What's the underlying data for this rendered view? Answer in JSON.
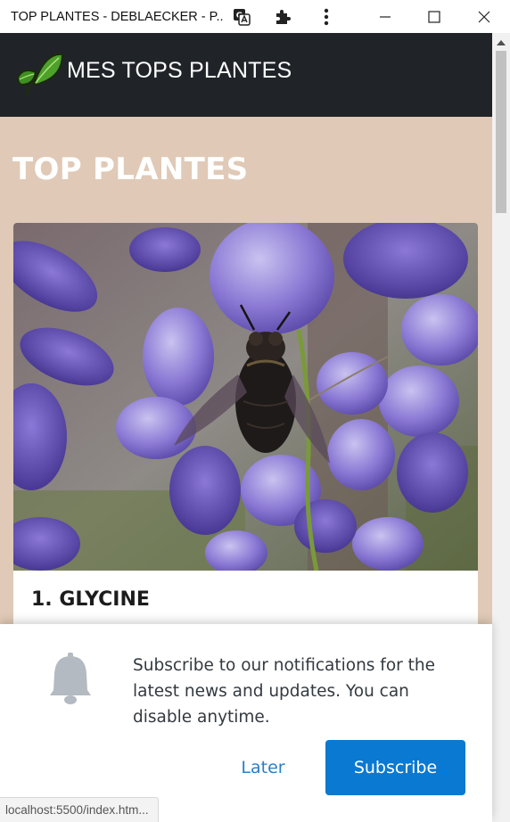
{
  "window": {
    "title": "TOP PLANTES - DEBLAECKER - P...",
    "icons": [
      "translate-icon",
      "extensions-icon",
      "more-menu-icon"
    ],
    "controls": [
      "minimize-icon",
      "maximize-icon",
      "close-icon"
    ]
  },
  "navbar": {
    "brand": "MES TOPS PLANTES",
    "logo": "leaf-logo"
  },
  "main": {
    "heading": "TOP PLANTES",
    "cards": [
      {
        "title": "1. GLYCINE",
        "image": "wisteria-with-bee-photo"
      }
    ]
  },
  "notification": {
    "message": "Subscribe to our notifications for the latest news and updates. You can disable anytime.",
    "later_label": "Later",
    "subscribe_label": "Subscribe",
    "icon": "bell-icon"
  },
  "status_url": "localhost:5500/index.htm...",
  "colors": {
    "navbar_bg": "#202428",
    "page_bg": "#e0c9b6",
    "accent": "#0a79d1",
    "link": "#2a7ec7"
  }
}
